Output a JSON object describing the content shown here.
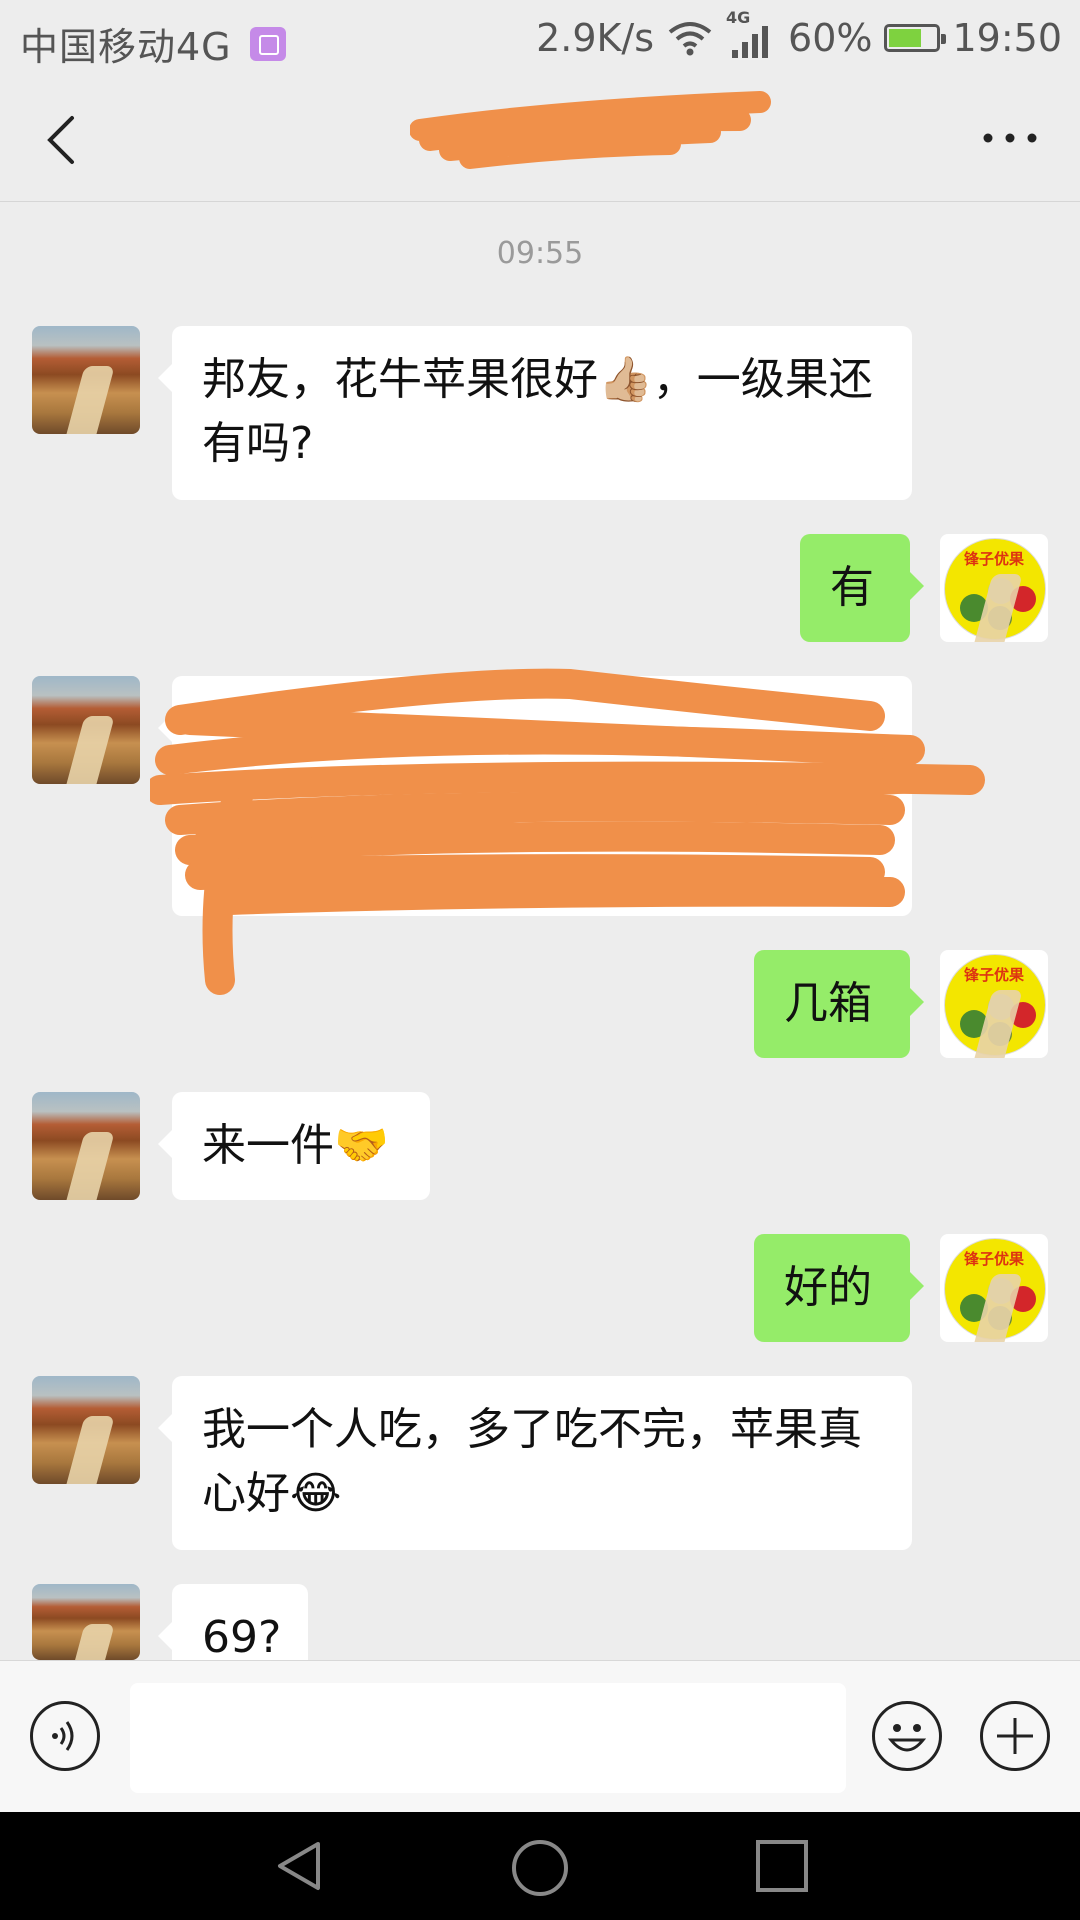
{
  "status_bar": {
    "carrier": "中国移动4G",
    "speed": "2.9K/s",
    "network": "4G",
    "battery": "60%",
    "time": "19:50"
  },
  "header": {
    "title": ""
  },
  "chat": {
    "timestamp": "09:55",
    "messages": [
      {
        "side": "left",
        "text": "邦友，花牛苹果很好👍🏼，一级果还有吗?"
      },
      {
        "side": "right",
        "text": "有"
      },
      {
        "side": "left",
        "text": ""
      },
      {
        "side": "right",
        "text": "几箱"
      },
      {
        "side": "left",
        "text": "来一件🤝"
      },
      {
        "side": "right",
        "text": "好的"
      },
      {
        "side": "left",
        "text": "我一个人吃，多了吃不完，苹果真心好😂"
      },
      {
        "side": "left",
        "text": "69?"
      }
    ],
    "my_avatar_text": "锋子优果"
  },
  "input_bar": {
    "placeholder": ""
  },
  "icons": {
    "back": "chevron-left-icon",
    "more": "more-dots-icon",
    "voice": "voice-icon",
    "emoji": "emoji-icon",
    "plus": "plus-icon"
  },
  "colors": {
    "background": "#ededed",
    "my_bubble": "#95ec69",
    "their_bubble": "#ffffff",
    "redaction": "#f0904a"
  }
}
